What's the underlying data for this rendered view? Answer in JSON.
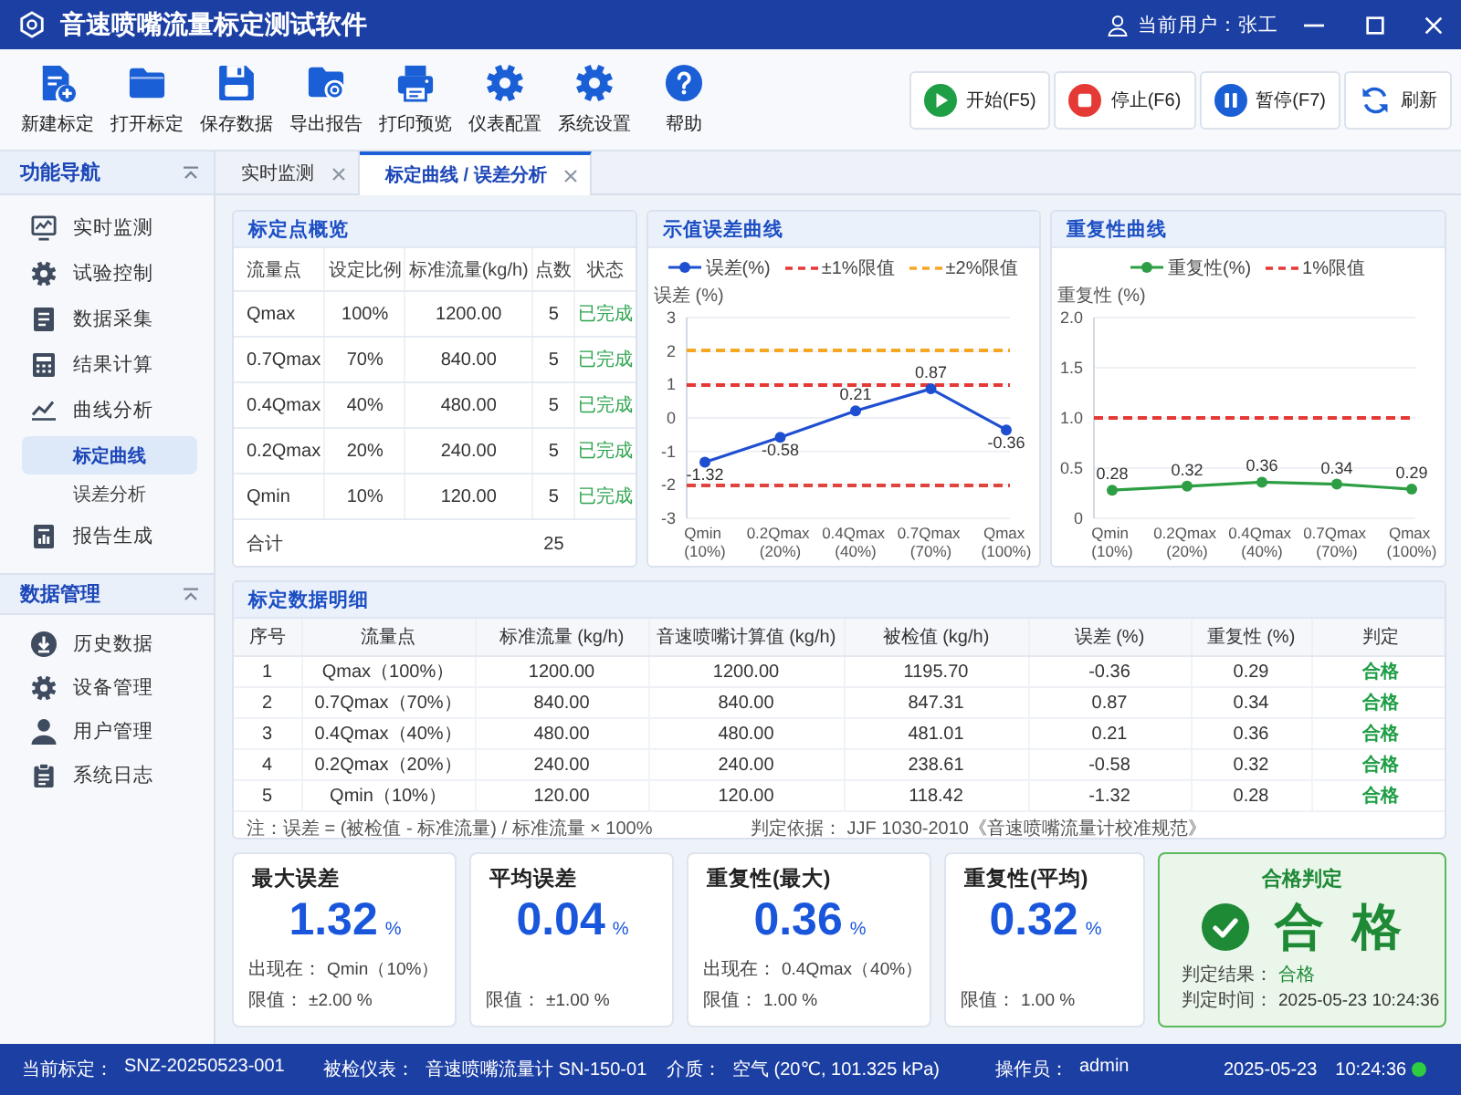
{
  "window": {
    "title": "音速喷嘴流量标定测试软件",
    "user": "当前用户：张工"
  },
  "toolbar": {
    "tools": [
      {
        "label": "新建标定"
      },
      {
        "label": "打开标定"
      },
      {
        "label": "保存数据"
      },
      {
        "label": "导出报告"
      },
      {
        "label": "打印预览"
      },
      {
        "label": "仪表配置"
      },
      {
        "label": "系统设置"
      },
      {
        "label": "帮助"
      }
    ],
    "actions": [
      {
        "kind": "start",
        "label": "开始(F5)"
      },
      {
        "kind": "stop",
        "label": "停止(F6)"
      },
      {
        "kind": "pause",
        "label": "暂停(F7)"
      },
      {
        "kind": "refresh",
        "label": "刷新"
      }
    ]
  },
  "sidebar": {
    "sections": [
      {
        "title": "功能导航",
        "items": [
          {
            "label": "实时监测",
            "selected": false
          },
          {
            "label": "试验控制",
            "selected": false
          },
          {
            "label": "数据采集",
            "selected": false
          },
          {
            "label": "结果计算",
            "selected": false
          },
          {
            "label": "曲线分析",
            "selected": false,
            "children": [
              {
                "label": "标定曲线",
                "selected": true
              },
              {
                "label": "误差分析",
                "selected": false
              }
            ]
          },
          {
            "label": "报告生成",
            "selected": false
          }
        ]
      },
      {
        "title": "数据管理",
        "items": [
          {
            "label": "历史数据",
            "selected": false
          },
          {
            "label": "设备管理",
            "selected": false
          },
          {
            "label": "用户管理",
            "selected": false
          },
          {
            "label": "系统日志",
            "selected": false
          }
        ]
      }
    ]
  },
  "tabs": [
    {
      "label": "实时监测",
      "selected": false
    },
    {
      "label": "标定曲线 / 误差分析",
      "selected": true
    }
  ],
  "overview": {
    "title": "标定点概览",
    "columns": [
      "流量点",
      "设定比例",
      "标准流量(kg/h)",
      "点数",
      "状态"
    ],
    "rows": [
      {
        "cells": [
          "Qmax",
          "100%",
          "1200.00",
          "5"
        ],
        "status": "已完成",
        "done": true
      },
      {
        "cells": [
          "0.7Qmax",
          "70%",
          "840.00",
          "5"
        ],
        "status": "已完成",
        "done": true
      },
      {
        "cells": [
          "0.4Qmax",
          "40%",
          "480.00",
          "5"
        ],
        "status": "已完成",
        "done": true
      },
      {
        "cells": [
          "0.2Qmax",
          "20%",
          "240.00",
          "5"
        ],
        "status": "已完成",
        "done": true
      },
      {
        "cells": [
          "Qmin",
          "10%",
          "120.00",
          "5"
        ],
        "status": "已完成",
        "done": true
      }
    ],
    "total": {
      "label": "合计",
      "count": "25"
    }
  },
  "error_chart": {
    "title": "示值误差曲线",
    "chart_data": {
      "type": "line",
      "legend": "top",
      "ylabel": "误差 (%)",
      "categories": [
        "Qmin (10%)",
        "0.2Qmax (20%)",
        "0.4Qmax (40%)",
        "0.7Qmax (70%)",
        "Qmax (100%)"
      ],
      "ylim": [
        -3,
        3
      ],
      "yticks": [
        -3,
        -2,
        -1,
        0,
        1,
        2,
        3
      ],
      "grid": true,
      "series": [
        {
          "name": "误差(%)",
          "color": "#1f4fd1",
          "marker": "circle",
          "values": [
            -1.32,
            -0.58,
            0.21,
            0.87,
            -0.36
          ]
        }
      ],
      "data_labels": true,
      "ref_lines": [
        {
          "axis": "y",
          "value": 1,
          "label": "±1%限值",
          "color": "#e53935"
        },
        {
          "axis": "y",
          "value": -2,
          "color": "#e0443c"
        },
        {
          "axis": "y",
          "value": 2,
          "label": "±2%限值",
          "color": "#f5a623"
        }
      ]
    }
  },
  "repeatability_chart": {
    "title": "重复性曲线",
    "chart_data": {
      "type": "line",
      "legend": "top",
      "ylabel": "重复性 (%)",
      "categories": [
        "Qmin (10%)",
        "0.2Qmax (20%)",
        "0.4Qmax (40%)",
        "0.7Qmax (70%)",
        "Qmax (100%)"
      ],
      "ylim": [
        0,
        2
      ],
      "yticks": [
        0,
        0.5,
        {
          "value": 1,
          "label": "1.0"
        },
        1.5,
        {
          "value": 2,
          "label": "2.0"
        }
      ],
      "grid": true,
      "series": [
        {
          "name": "重复性(%)",
          "color": "#2e9e44",
          "marker": "circle",
          "values": [
            0.28,
            0.32,
            0.36,
            0.34,
            0.29
          ]
        }
      ],
      "data_labels": true,
      "ref_lines": [
        {
          "axis": "y",
          "value": 1,
          "label": "1%限值",
          "color": "#e53935"
        }
      ]
    }
  },
  "details": {
    "title": "标定数据明细",
    "columns": [
      "序号",
      "流量点",
      "标准流量 (kg/h)",
      "音速喷嘴计算值 (kg/h)",
      "被检值 (kg/h)",
      "误差 (%)",
      "重复性 (%)",
      "判定"
    ],
    "rows": [
      {
        "cells": [
          "1",
          "Qmax（100%）",
          "1200.00",
          "1200.00",
          "1195.70",
          "-0.36",
          "0.29"
        ],
        "verdict": "合格",
        "pass": true
      },
      {
        "cells": [
          "2",
          "0.7Qmax（70%）",
          "840.00",
          "840.00",
          "847.31",
          "0.87",
          "0.34"
        ],
        "verdict": "合格",
        "pass": true
      },
      {
        "cells": [
          "3",
          "0.4Qmax（40%）",
          "480.00",
          "480.00",
          "481.01",
          "0.21",
          "0.36"
        ],
        "verdict": "合格",
        "pass": true
      },
      {
        "cells": [
          "4",
          "0.2Qmax（20%）",
          "240.00",
          "240.00",
          "238.61",
          "-0.58",
          "0.32"
        ],
        "verdict": "合格",
        "pass": true
      },
      {
        "cells": [
          "5",
          "Qmin（10%）",
          "120.00",
          "120.00",
          "118.42",
          "-1.32",
          "0.28"
        ],
        "verdict": "合格",
        "pass": true
      }
    ],
    "note": "注：误差 = (被检值 - 标准流量) / 标准流量 × 100%",
    "basis": "判定依据： JJF 1030-2010《音速喷嘴流量计校准规范》"
  },
  "summary": {
    "cards": [
      {
        "title": "最大误差",
        "value": "1.32",
        "unit": "%",
        "details": [
          {
            "label": "出现在：",
            "value": "Qmin（10%）"
          },
          {
            "label": "限值：",
            "value": "±2.00 %"
          }
        ]
      },
      {
        "title": "平均误差",
        "value": "0.04",
        "unit": "%",
        "details": [
          {
            "label": "限值：",
            "value": "±1.00 %"
          }
        ]
      },
      {
        "title": "重复性(最大)",
        "value": "0.36",
        "unit": "%",
        "details": [
          {
            "label": "出现在：",
            "value": "0.4Qmax（40%）"
          },
          {
            "label": "限值：",
            "value": "1.00 %"
          }
        ]
      },
      {
        "title": "重复性(平均)",
        "value": "0.32",
        "unit": "%",
        "details": [
          {
            "label": "限值：",
            "value": "1.00 %"
          }
        ]
      }
    ],
    "verdict": {
      "title": "合格判定",
      "pass": true,
      "result": "合 格",
      "details": [
        {
          "kind": "result",
          "label": "判定结果：",
          "value": "合格"
        },
        {
          "kind": "time",
          "label": "判定时间：",
          "value": "2025-05-23 10:24:36"
        }
      ]
    }
  },
  "status_bar": {
    "fields": [
      {
        "label": "当前标定：",
        "value": "SNZ-20250523-001"
      },
      {
        "label": "被检仪表：",
        "value": "音速喷嘴流量计 SN-150-01"
      },
      {
        "label": "介质：",
        "value": "空气 (20℃, 101.325 kPa)"
      },
      {
        "label": "操作员：",
        "value": "admin"
      }
    ],
    "date": "2025-05-23",
    "time": "10:24:36",
    "online": true
  }
}
